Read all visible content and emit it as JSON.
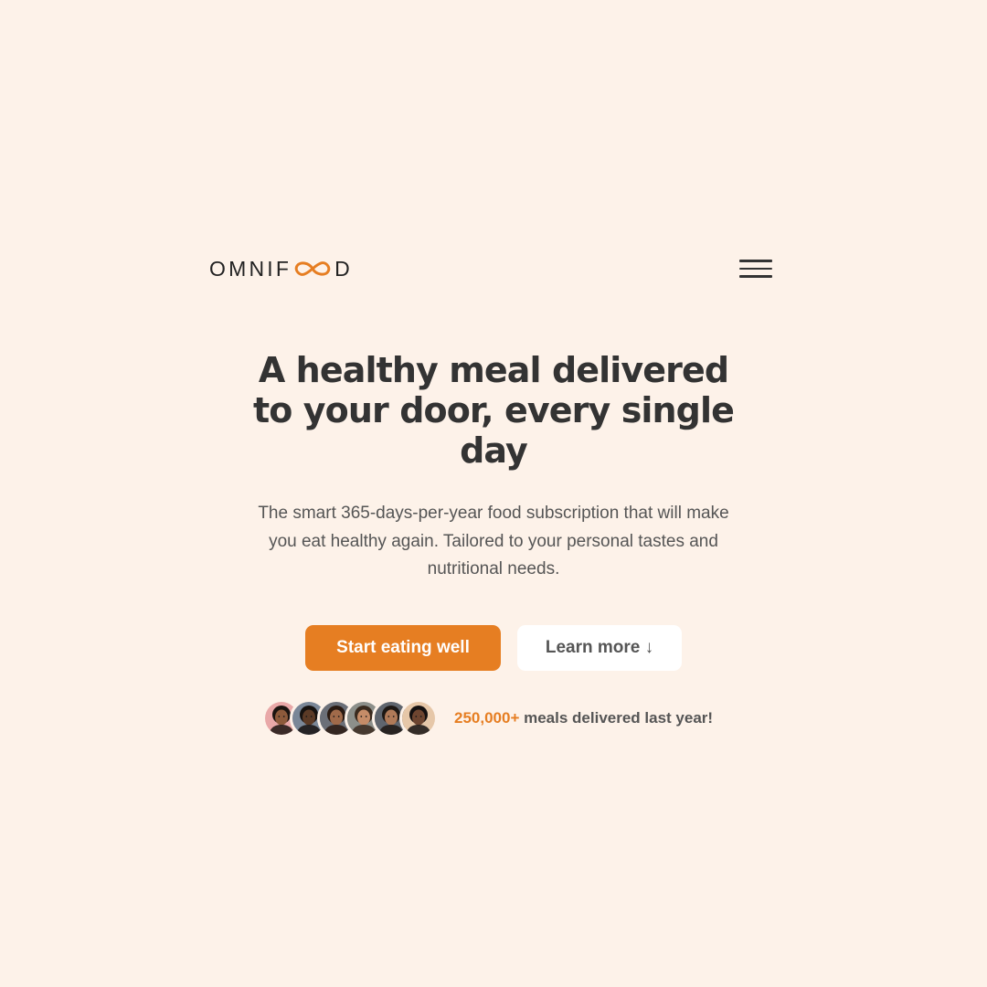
{
  "header": {
    "logo_prefix": "OMNIF",
    "logo_suffix": "D",
    "logo_icon": "infinity-icon",
    "menu_icon": "hamburger-menu-icon"
  },
  "hero": {
    "title": "A healthy meal delivered to your door, every single day",
    "description": "The smart 365-days-per-year food subscription that will make you eat healthy again. Tailored to your personal tastes and nutritional needs.",
    "primary_button": "Start eating well",
    "secondary_button": "Learn more ↓"
  },
  "delivered": {
    "count": "250,000+",
    "text": " meals delivered last year!",
    "avatars": [
      {
        "skin": "#8d5a3b",
        "hair": "#1b1410",
        "bg": "#e9a8a8"
      },
      {
        "skin": "#5b3a26",
        "hair": "#161210",
        "bg": "#7a8798"
      },
      {
        "skin": "#a06a4a",
        "hair": "#2a1a12",
        "bg": "#6b6f78"
      },
      {
        "skin": "#c58c68",
        "hair": "#3a2a1e",
        "bg": "#8c8f8a"
      },
      {
        "skin": "#b07a58",
        "hair": "#1e1814",
        "bg": "#5f656e"
      },
      {
        "skin": "#6e4530",
        "hair": "#141010",
        "bg": "#e6c7a8"
      }
    ]
  },
  "colors": {
    "background": "#fdf2e9",
    "accent": "#e67e22",
    "text_dark": "#333333",
    "text_body": "#555555"
  }
}
